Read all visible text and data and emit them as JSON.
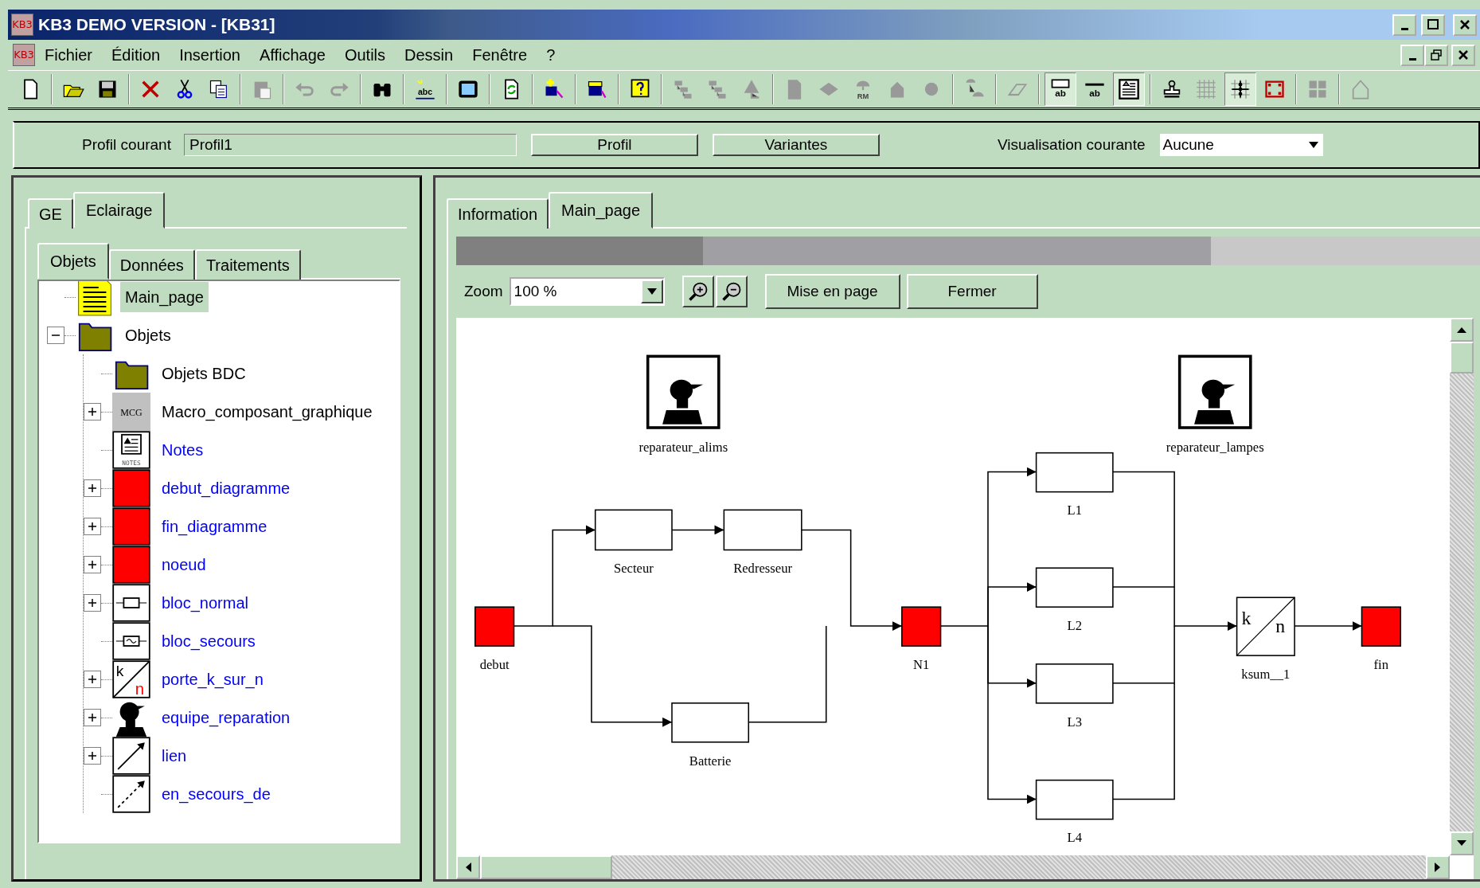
{
  "window": {
    "title": "KB3 DEMO VERSION - [KB31]",
    "logo_text": "KB3"
  },
  "menu": {
    "logo_text": "KB3",
    "items": [
      "Fichier",
      "Édition",
      "Insertion",
      "Affichage",
      "Outils",
      "Dessin",
      "Fenêtre",
      "?"
    ]
  },
  "toolbar": [
    {
      "kind": "new",
      "disabled": false,
      "pressed": false
    },
    {
      "kind": "separator"
    },
    {
      "kind": "open",
      "disabled": false,
      "pressed": false
    },
    {
      "kind": "save",
      "disabled": false,
      "pressed": false
    },
    {
      "kind": "separator"
    },
    {
      "kind": "delete",
      "disabled": false,
      "pressed": false
    },
    {
      "kind": "cut",
      "disabled": false,
      "pressed": false
    },
    {
      "kind": "copy",
      "disabled": false,
      "pressed": false
    },
    {
      "kind": "separator"
    },
    {
      "kind": "paste",
      "disabled": true,
      "pressed": false
    },
    {
      "kind": "separator"
    },
    {
      "kind": "undo",
      "disabled": true,
      "pressed": false
    },
    {
      "kind": "redo",
      "disabled": true,
      "pressed": false
    },
    {
      "kind": "separator"
    },
    {
      "kind": "find",
      "disabled": false,
      "pressed": false
    },
    {
      "kind": "separator"
    },
    {
      "kind": "spell",
      "text": "abc",
      "disabled": false,
      "pressed": false
    },
    {
      "kind": "separator"
    },
    {
      "kind": "screen",
      "disabled": false,
      "pressed": false
    },
    {
      "kind": "separator"
    },
    {
      "kind": "refresh",
      "disabled": false,
      "pressed": false
    },
    {
      "kind": "separator"
    },
    {
      "kind": "add-object",
      "disabled": false,
      "pressed": false
    },
    {
      "kind": "separator"
    },
    {
      "kind": "edit-object",
      "disabled": false,
      "pressed": false
    },
    {
      "kind": "separator"
    },
    {
      "kind": "help",
      "disabled": false,
      "pressed": false
    },
    {
      "kind": "separator"
    },
    {
      "kind": "tree",
      "disabled": true,
      "pressed": false
    },
    {
      "kind": "tree",
      "disabled": true,
      "pressed": false
    },
    {
      "kind": "triangle",
      "disabled": true,
      "pressed": false
    },
    {
      "kind": "separator"
    },
    {
      "kind": "page",
      "disabled": true,
      "pressed": false
    },
    {
      "kind": "diamond",
      "disabled": true,
      "pressed": false
    },
    {
      "kind": "umbrella",
      "text": "RM",
      "disabled": true,
      "pressed": false
    },
    {
      "kind": "house",
      "disabled": true,
      "pressed": false
    },
    {
      "kind": "circle",
      "disabled": true,
      "pressed": false
    },
    {
      "kind": "separator"
    },
    {
      "kind": "shapes",
      "disabled": true,
      "pressed": false
    },
    {
      "kind": "separator"
    },
    {
      "kind": "eraser",
      "disabled": true,
      "pressed": false
    },
    {
      "kind": "separator"
    },
    {
      "kind": "text-box",
      "text": "ab",
      "disabled": false,
      "pressed": true
    },
    {
      "kind": "text-line",
      "text": "ab",
      "disabled": false,
      "pressed": false
    },
    {
      "kind": "document",
      "disabled": false,
      "pressed": true
    },
    {
      "kind": "separator"
    },
    {
      "kind": "stamp",
      "disabled": false,
      "pressed": false
    },
    {
      "kind": "grid",
      "disabled": true,
      "pressed": false
    },
    {
      "kind": "snap-grid",
      "disabled": false,
      "pressed": true
    },
    {
      "kind": "frame",
      "disabled": false,
      "pressed": false
    },
    {
      "kind": "separator"
    },
    {
      "kind": "tiles",
      "disabled": true,
      "pressed": false
    },
    {
      "kind": "separator"
    },
    {
      "kind": "house-outline",
      "disabled": true,
      "pressed": false
    }
  ],
  "profile_bar": {
    "label": "Profil courant",
    "profile_value": "Profil1",
    "buttons": [
      "Profil",
      "Variantes"
    ],
    "view_label": "Visualisation courante",
    "view_value": "Aucune"
  },
  "left_panel": {
    "tabs": [
      {
        "label": "GE",
        "selected": false
      },
      {
        "label": "Eclairage",
        "selected": true
      }
    ],
    "subtabs": [
      {
        "label": "Objets",
        "selected": true
      },
      {
        "label": "Données",
        "selected": false
      },
      {
        "label": "Traitements",
        "selected": false
      }
    ],
    "tree": [
      {
        "label": "Main_page",
        "kind": "page",
        "expandable": false,
        "selected": true,
        "color": "#000000"
      },
      {
        "label": "Objets",
        "kind": "folder",
        "expandable": true,
        "expanded": true,
        "selected": false,
        "color": "#000000",
        "children": [
          {
            "label": "Objets BDC",
            "kind": "folder",
            "expandable": false,
            "selected": false,
            "color": "#000000"
          },
          {
            "label": "Macro_composant_graphique",
            "kind": "macro",
            "icon_text": [
              "MCG"
            ],
            "expandable": true,
            "expanded": false,
            "selected": false,
            "color": "#000000"
          },
          {
            "label": "Notes",
            "kind": "notes",
            "icon_text": [
              "NOTES"
            ],
            "expandable": false,
            "selected": false,
            "color": "#0000ff"
          },
          {
            "label": "debut_diagramme",
            "kind": "event",
            "expandable": true,
            "expanded": false,
            "selected": false,
            "color": "#0000ff"
          },
          {
            "label": "fin_diagramme",
            "kind": "event",
            "expandable": true,
            "expanded": false,
            "selected": false,
            "color": "#0000ff"
          },
          {
            "label": "noeud",
            "kind": "event",
            "expandable": true,
            "expanded": false,
            "selected": false,
            "color": "#0000ff"
          },
          {
            "label": "bloc_normal",
            "kind": "block",
            "expandable": true,
            "expanded": false,
            "selected": false,
            "color": "#0000ff"
          },
          {
            "label": "bloc_secours",
            "kind": "backup-block",
            "expandable": false,
            "selected": false,
            "color": "#0000ff"
          },
          {
            "label": "porte_k_sur_n",
            "kind": "gate",
            "icon_text": [
              "k",
              "n"
            ],
            "expandable": true,
            "expanded": false,
            "selected": false,
            "color": "#0000ff"
          },
          {
            "label": "equipe_reparation",
            "kind": "team",
            "expandable": true,
            "expanded": false,
            "selected": false,
            "color": "#0000ff"
          },
          {
            "label": "lien",
            "kind": "link",
            "expandable": true,
            "expanded": false,
            "selected": false,
            "color": "#0000ff"
          },
          {
            "label": "en_secours_de",
            "kind": "backup-link",
            "expandable": false,
            "selected": false,
            "color": "#0000ff"
          }
        ]
      }
    ]
  },
  "right_panel": {
    "tabs": [
      {
        "label": "Information",
        "selected": false
      },
      {
        "label": "Main_page",
        "selected": true
      }
    ],
    "zoom_label": "Zoom",
    "zoom_value": "100 %",
    "buttons": [
      "Mise en page",
      "Fermer"
    ],
    "diagram": {
      "nodes": [
        {
          "label": "reparateur_alims",
          "kind": "team"
        },
        {
          "label": "reparateur_lampes",
          "kind": "team"
        },
        {
          "label": "debut",
          "kind": "event"
        },
        {
          "label": "Secteur",
          "kind": "block"
        },
        {
          "label": "Redresseur",
          "kind": "block"
        },
        {
          "label": "Batterie",
          "kind": "block"
        },
        {
          "label": "N1",
          "kind": "event"
        },
        {
          "label": "L1",
          "kind": "block"
        },
        {
          "label": "L2",
          "kind": "block"
        },
        {
          "label": "L3",
          "kind": "block"
        },
        {
          "label": "L4",
          "kind": "block"
        },
        {
          "label": "ksum__1",
          "kind": "gate",
          "gate_text": [
            "k",
            "n"
          ]
        },
        {
          "label": "fin",
          "kind": "event"
        }
      ]
    }
  }
}
